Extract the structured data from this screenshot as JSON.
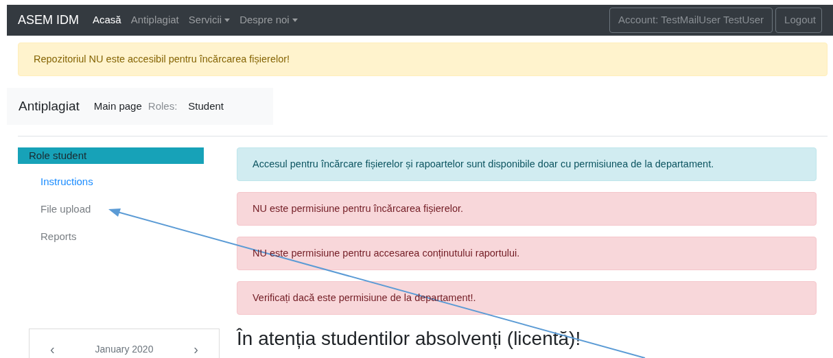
{
  "navbar": {
    "brand": "ASEM IDM",
    "items": [
      {
        "label": "Acasă",
        "selected": true,
        "dropdown": false
      },
      {
        "label": "Antiplagiat",
        "selected": false,
        "dropdown": false
      },
      {
        "label": "Servicii",
        "selected": false,
        "dropdown": true
      },
      {
        "label": "Despre noi",
        "selected": false,
        "dropdown": true
      }
    ],
    "account": "Account: TestMailUser TestUser",
    "logout": "Logout"
  },
  "warning": "Repozitoriul NU este accesibil pentru încărcarea fișierelor!",
  "breadcrumb": {
    "title": "Antiplagiat",
    "page": "Main page",
    "roles_label": "Roles:",
    "role": "Student"
  },
  "sidebar": {
    "header": "Role student",
    "items": [
      {
        "label": "Instructions",
        "selected": true
      },
      {
        "label": "File upload",
        "selected": false
      },
      {
        "label": "Reports",
        "selected": false
      }
    ]
  },
  "alerts": [
    {
      "kind": "info",
      "text": "Accesul pentru încărcare fișierelor și rapoartelor sunt disponibile doar cu permisiunea de la departament."
    },
    {
      "kind": "danger",
      "text": "NU este permisiune pentru încărcarea fișierelor."
    },
    {
      "kind": "danger",
      "text": "NU este permisiune pentru accesarea conținutului raportului."
    },
    {
      "kind": "danger",
      "text": "Verificați dacă este permisiune de la departament!."
    }
  ],
  "heading": "În atenția studentilor absolvenți (licentă)!",
  "calendar": {
    "prev": "‹",
    "month": "January 2020",
    "next": "›"
  }
}
